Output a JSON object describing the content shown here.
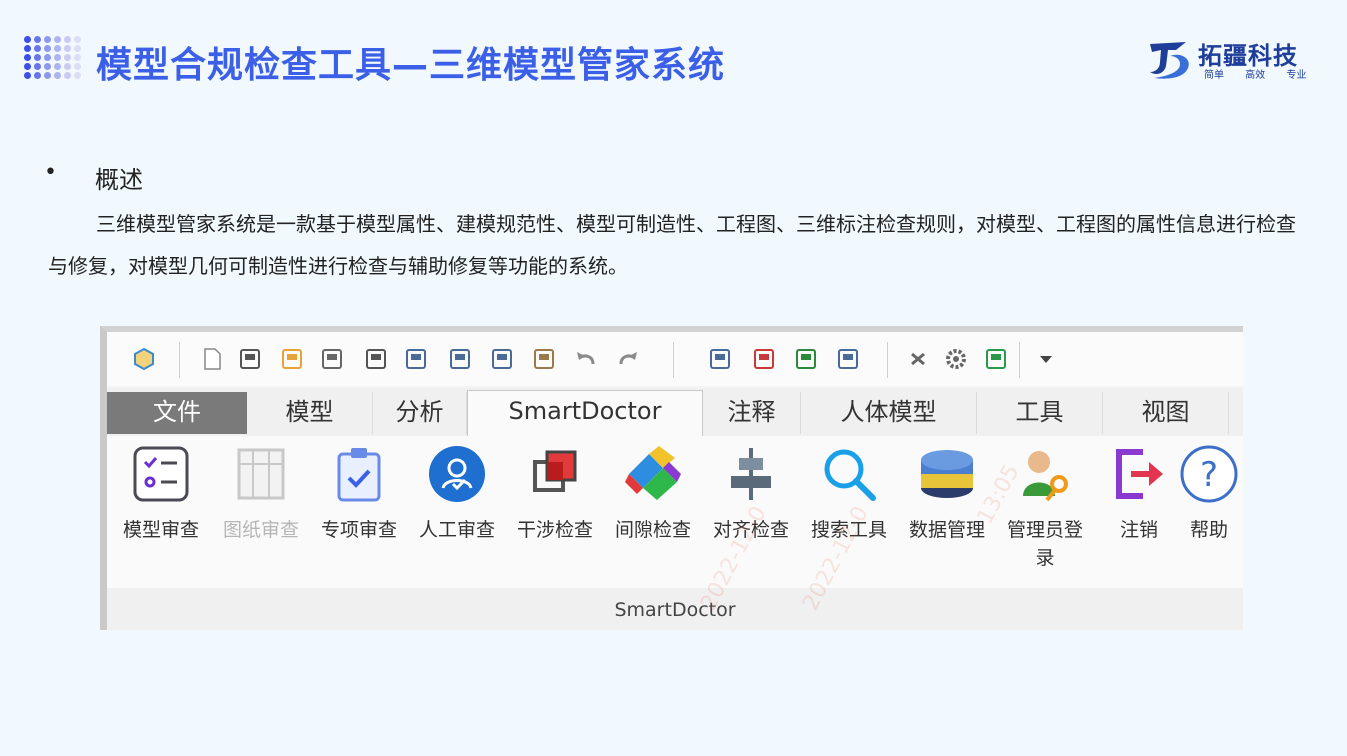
{
  "header": {
    "title": "模型合规检查工具—三维模型管家系统",
    "logo_text": "拓疆科技",
    "logo_slogan": "简单 高效 专业"
  },
  "content": {
    "bullet": "•",
    "subtitle": "概述",
    "paragraph": "三维模型管家系统是一款基于模型属性、建模规范性、模型可制造性、工程图、三维标注检查规则，对模型、工程图的属性信息进行检查与修复，对模型几何可制造性进行检查与辅助修复等功能的系统。"
  },
  "ribbon": {
    "quick_access_icons": [
      "cube-icon",
      "new-file-icon",
      "save-as-icon",
      "open-folder-icon",
      "import-icon",
      "save-icon",
      "send-icon",
      "export-icon",
      "document-icon",
      "clipboard-check-icon",
      "undo-icon",
      "redo-icon",
      "tree-icon",
      "edit-pencil-icon",
      "network-icon",
      "layout-icon",
      "close-x-icon",
      "gear-icon",
      "check-frame-icon",
      "dropdown-icon"
    ],
    "tabs": [
      {
        "label": "文件"
      },
      {
        "label": "模型"
      },
      {
        "label": "分析"
      },
      {
        "label": "SmartDoctor"
      },
      {
        "label": "注释"
      },
      {
        "label": "人体模型"
      },
      {
        "label": "工具"
      },
      {
        "label": "视图"
      }
    ],
    "tools": [
      {
        "label": "模型审查",
        "icon": "checklist-icon"
      },
      {
        "label": "图纸审查",
        "icon": "drawing-icon",
        "disabled": true
      },
      {
        "label": "专项审查",
        "icon": "clipboard-icon"
      },
      {
        "label": "人工审查",
        "icon": "person-check-icon"
      },
      {
        "label": "干涉检查",
        "icon": "interference-icon"
      },
      {
        "label": "间隙检查",
        "icon": "clearance-icon"
      },
      {
        "label": "对齐检查",
        "icon": "align-icon"
      },
      {
        "label": "搜索工具",
        "icon": "search-icon"
      },
      {
        "label": "数据管理",
        "icon": "database-icon"
      },
      {
        "label": "管理员登录",
        "icon": "admin-key-icon"
      },
      {
        "label": "注销",
        "icon": "logout-icon"
      },
      {
        "label": "帮助",
        "icon": "help-icon"
      }
    ],
    "group_label": "SmartDoctor",
    "watermarks": [
      "2022-12-0",
      "2022-12-0",
      "13:05"
    ]
  },
  "colors": {
    "title": "#3c5fe8",
    "logo": "#1f3e9a",
    "background": "#f1f9fe"
  }
}
